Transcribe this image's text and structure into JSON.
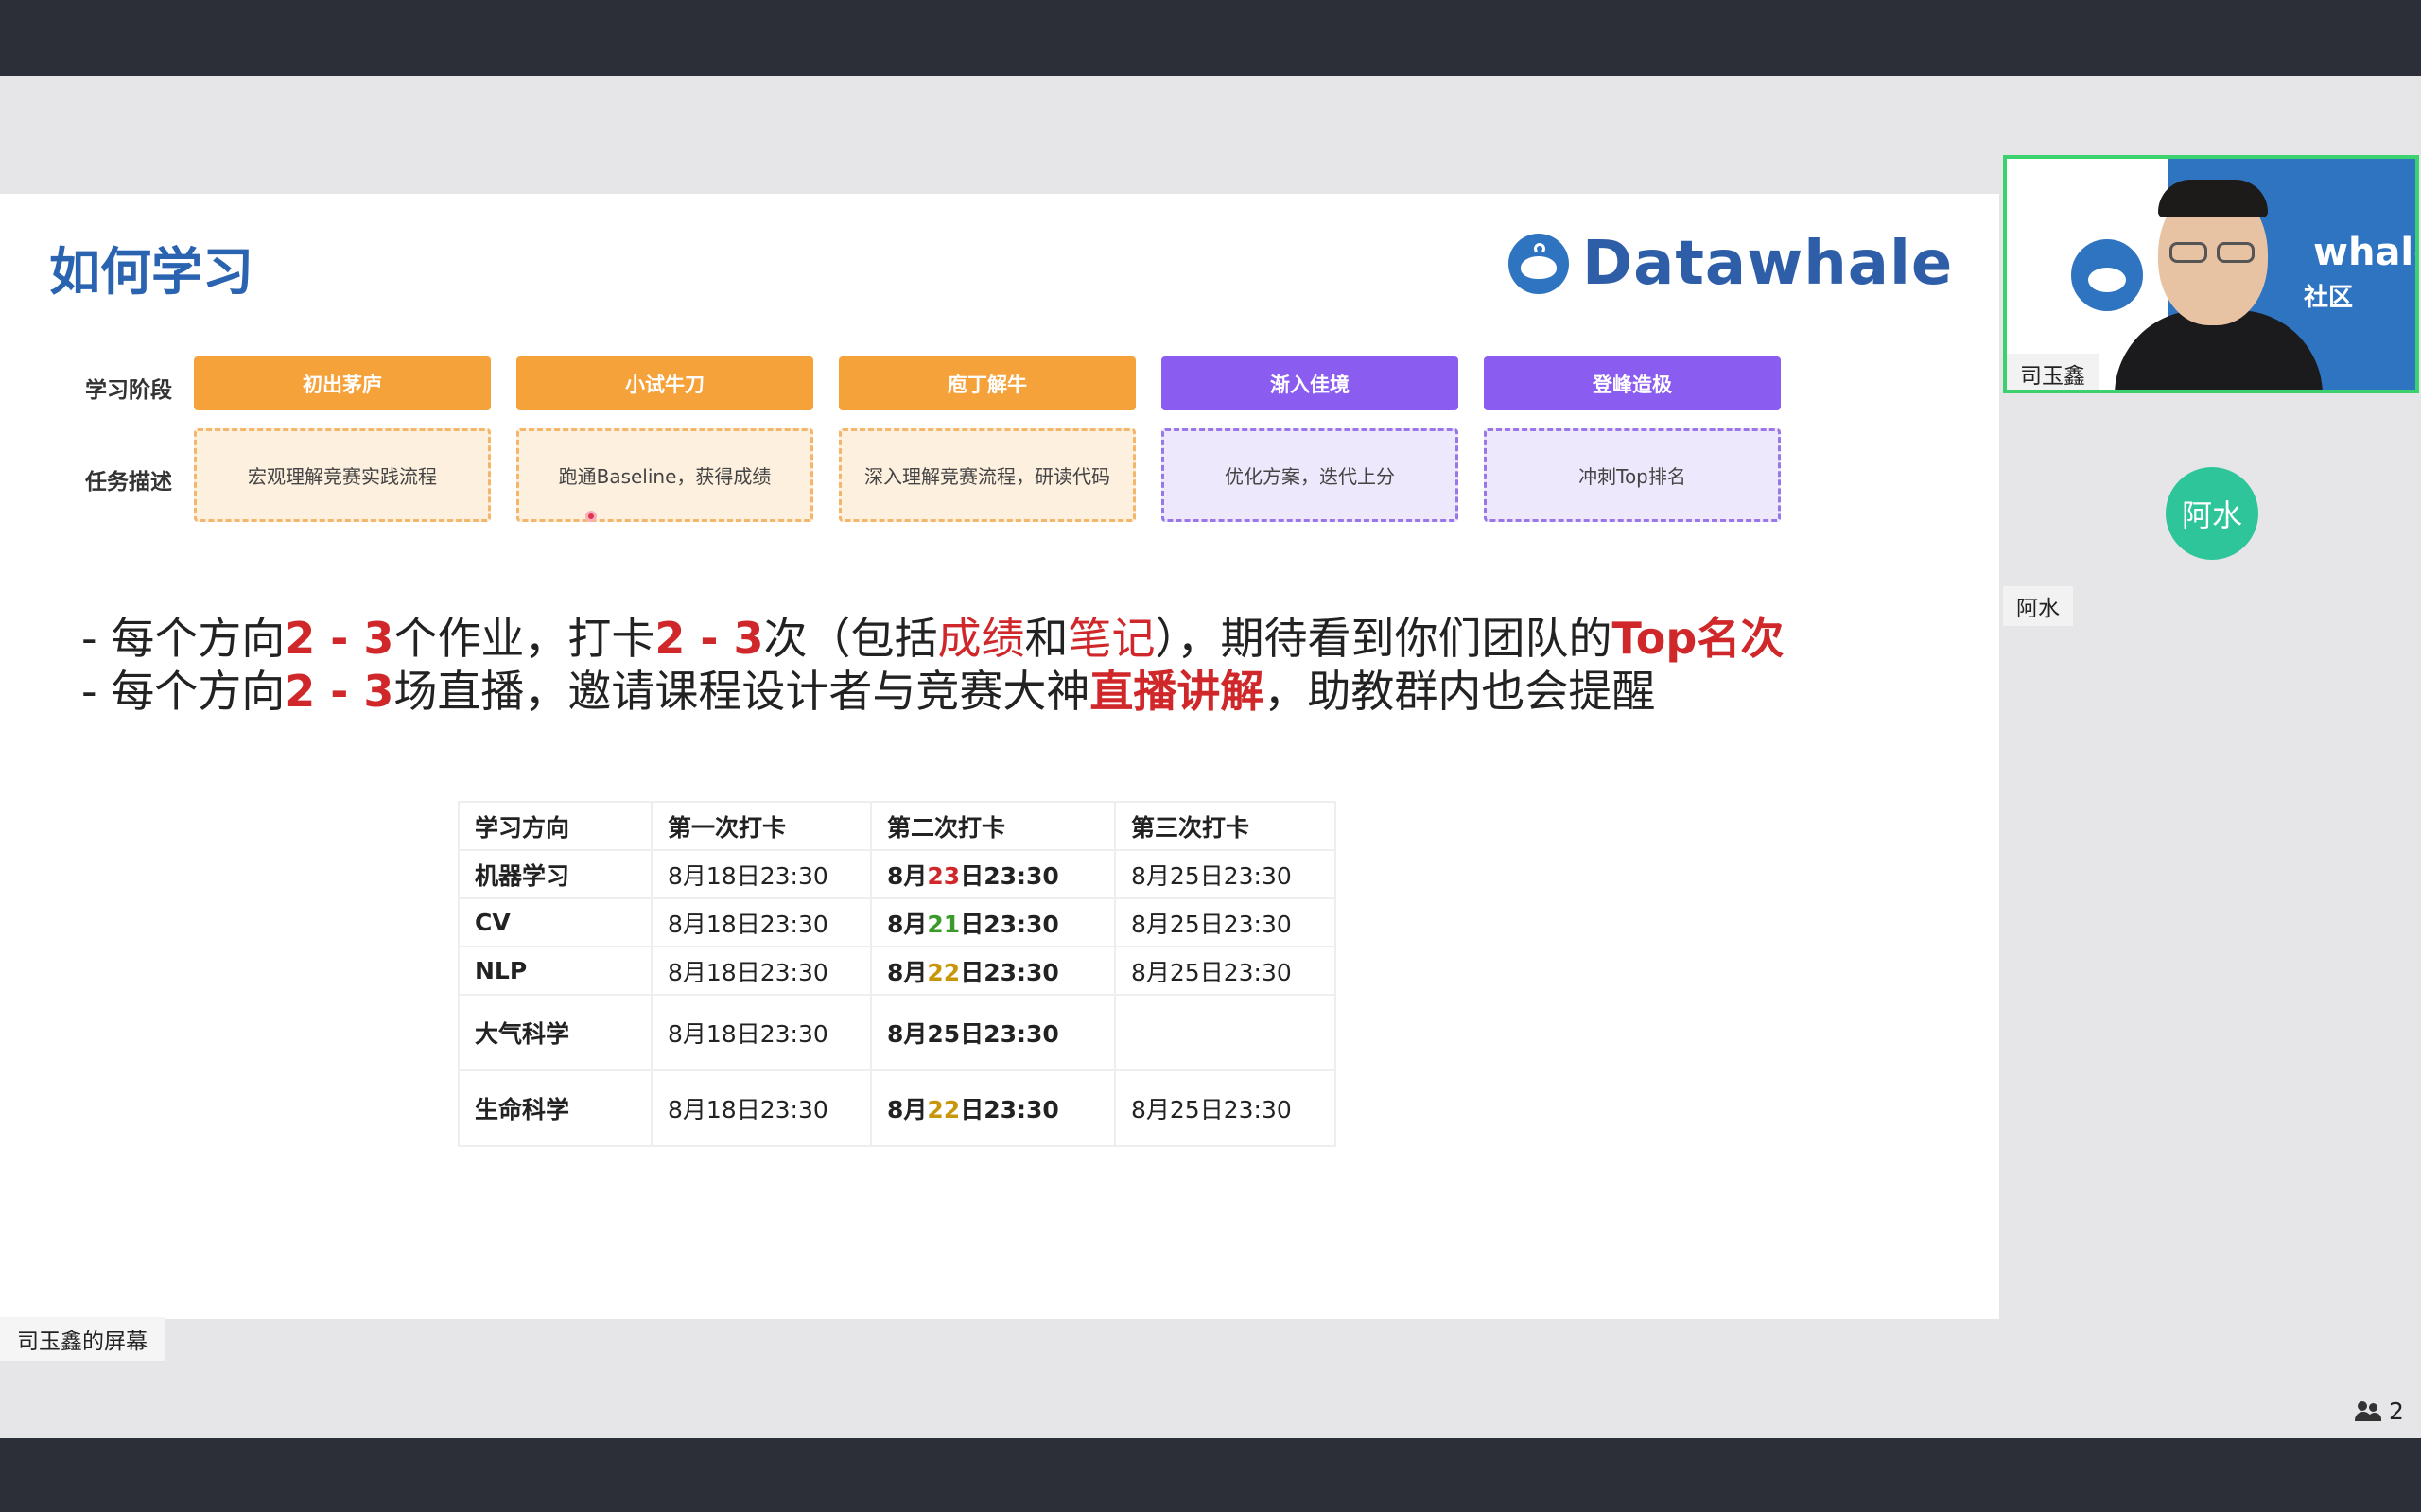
{
  "slide": {
    "title": "如何学习",
    "logo_text": "Datawhale",
    "stage_label": "学习阶段",
    "task_label": "任务描述",
    "stages": [
      {
        "name": "初出茅庐",
        "task": "宏观理解竞赛实践流程",
        "color": "orange"
      },
      {
        "name": "小试牛刀",
        "task": "跑通Baseline，获得成绩",
        "color": "orange"
      },
      {
        "name": "庖丁解牛",
        "task": "深入理解竞赛流程，研读代码",
        "color": "orange"
      },
      {
        "name": "渐入佳境",
        "task": "优化方案，迭代上分",
        "color": "purple"
      },
      {
        "name": "登峰造极",
        "task": "冲刺Top排名",
        "color": "purple"
      }
    ],
    "bullet1": {
      "p1": "- 每个方向",
      "n1": "2 - 3",
      "p2": "个作业，打卡",
      "n2": "2 - 3",
      "p3": "次（包括",
      "h1": "成绩",
      "p4": "和",
      "h2": "笔记",
      "p5": "），期待看到你们团队的",
      "h3": "Top名次"
    },
    "bullet2": {
      "p1": "- 每个方向",
      "n1": "2 - 3",
      "p2": "场直播，邀请课程设计者与竞赛大神",
      "h1": "直播讲解",
      "p3": "，助教群内也会提醒"
    },
    "table": {
      "headers": [
        "学习方向",
        "第一次打卡",
        "第二次打卡",
        "第三次打卡"
      ],
      "rows": [
        {
          "dir": "机器学习",
          "first": "8月18日23:30",
          "second_pre": "8月",
          "second_day": "23",
          "second_post": "日23:30",
          "third": "8月25日23:30"
        },
        {
          "dir": "CV",
          "first": "8月18日23:30",
          "second_pre": "8月",
          "second_day": "21",
          "second_post": "日23:30",
          "third": "8月25日23:30"
        },
        {
          "dir": "NLP",
          "first": "8月18日23:30",
          "second_pre": "8月",
          "second_day": "22",
          "second_post": "日23:30",
          "third": "8月25日23:30"
        },
        {
          "dir": "大气科学",
          "first": "8月18日23:30",
          "second_pre": "8月25日23:30",
          "second_day": "",
          "second_post": "",
          "third": ""
        },
        {
          "dir": "生命科学",
          "first": "8月18日23:30",
          "second_pre": "8月",
          "second_day": "22",
          "second_post": "日23:30",
          "third": "8月25日23:30"
        }
      ]
    }
  },
  "meeting": {
    "screen_owner": "司玉鑫的屏幕",
    "presenter_name": "司玉鑫",
    "video_bg_text": "whale",
    "video_bg_sub": "社区",
    "participant2_avatar": "阿水",
    "participant2_name": "阿水",
    "participant_count": "2"
  },
  "colors": {
    "title_blue": "#2a63b0",
    "stage_orange": "#f6a23a",
    "stage_purple": "#8b5cf0",
    "highlight_red": "#d0282a",
    "active_speaker_border": "#3bd16f",
    "avatar_green": "#2fc59a"
  }
}
